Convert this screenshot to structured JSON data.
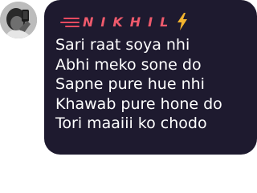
{
  "sender": {
    "name": "NIKHIL",
    "name_color": "#ef5a6c",
    "badge_icon": "lightning-bolt-icon",
    "avatar_icon": "profile-photo-avatar"
  },
  "message": {
    "lines": [
      "Sari raat soya nhi",
      "Abhi meko sone do",
      "Sapne pure hue nhi",
      "Khawab pure hone do",
      "Tori maaiii ko chodo"
    ],
    "bubble_color": "#1e1a2f",
    "text_color": "#ffffff"
  }
}
